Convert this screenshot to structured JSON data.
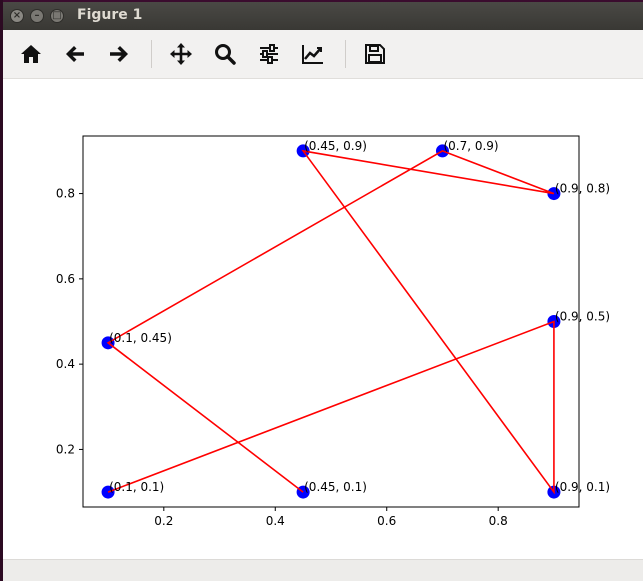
{
  "window": {
    "title": "Figure 1"
  },
  "toolbar": {
    "buttons": [
      {
        "name": "home",
        "icon": "home-icon"
      },
      {
        "name": "back",
        "icon": "arrow-left-icon"
      },
      {
        "name": "forward",
        "icon": "arrow-right-icon"
      },
      {
        "name": "pan",
        "icon": "move-icon"
      },
      {
        "name": "zoom",
        "icon": "magnifier-icon"
      },
      {
        "name": "configure-subplots",
        "icon": "sliders-icon"
      },
      {
        "name": "edit-axes",
        "icon": "line-chart-icon"
      },
      {
        "name": "save",
        "icon": "floppy-disk-icon"
      }
    ]
  },
  "status": {
    "message": ""
  },
  "chart_data": {
    "type": "scatter",
    "title": "",
    "xlabel": "",
    "ylabel": "",
    "xlim": [
      0.055,
      0.945
    ],
    "ylim": [
      0.065,
      0.935
    ],
    "x_ticks": [
      0.2,
      0.4,
      0.6,
      0.8
    ],
    "y_ticks": [
      0.2,
      0.4,
      0.6,
      0.8
    ],
    "x_tick_labels": [
      "0.2",
      "0.4",
      "0.6",
      "0.8"
    ],
    "y_tick_labels": [
      "0.2",
      "0.4",
      "0.6",
      "0.8"
    ],
    "grid": false,
    "marker_color": "#0000ff",
    "line_color": "#ff0000",
    "points": [
      {
        "x": 0.1,
        "y": 0.1,
        "label": "(0.1, 0.1)"
      },
      {
        "x": 0.9,
        "y": 0.5,
        "label": "(0.9, 0.5)"
      },
      {
        "x": 0.9,
        "y": 0.1,
        "label": "(0.9, 0.1)"
      },
      {
        "x": 0.45,
        "y": 0.9,
        "label": "(0.45, 0.9)"
      },
      {
        "x": 0.9,
        "y": 0.8,
        "label": "(0.9, 0.8)"
      },
      {
        "x": 0.7,
        "y": 0.9,
        "label": "(0.7, 0.9)"
      },
      {
        "x": 0.1,
        "y": 0.45,
        "label": "(0.1, 0.45)"
      },
      {
        "x": 0.45,
        "y": 0.1,
        "label": "(0.45, 0.1)"
      }
    ],
    "path_order": [
      0,
      1,
      2,
      3,
      4,
      5,
      6,
      7
    ]
  }
}
